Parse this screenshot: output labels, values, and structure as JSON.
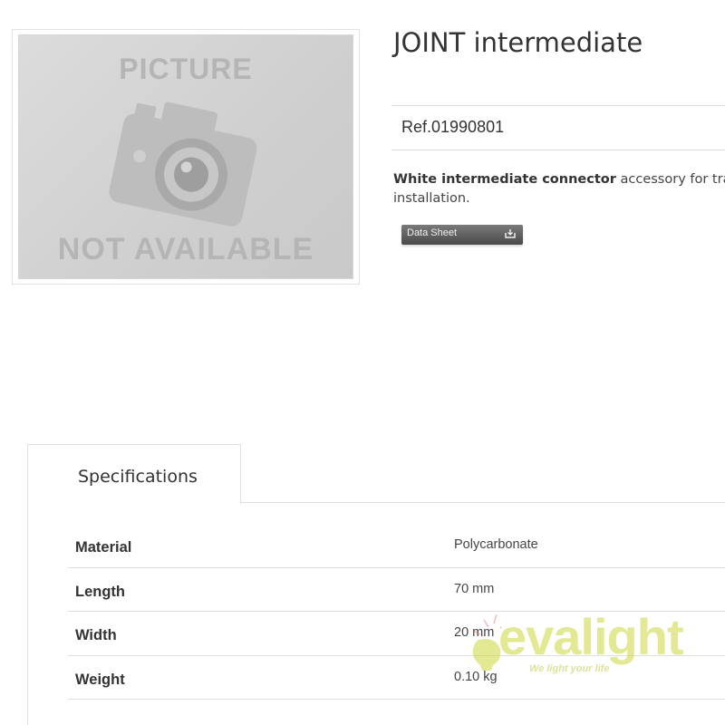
{
  "image_placeholder": {
    "top_text": "PICTURE",
    "bottom_text": "NOT AVAILABLE",
    "icon": "camera-icon"
  },
  "product": {
    "title": "JOINT intermediate",
    "reference": "Ref.01990801",
    "description_bold": "White intermediate connector",
    "description_rest": " accessory for track",
    "description_line2": "installation.",
    "datasheet_button": "Data Sheet",
    "datasheet_icon": "download-icon"
  },
  "tabs": [
    {
      "label": "Specifications",
      "active": true
    }
  ],
  "specifications": [
    {
      "label": "Material",
      "value": "Polycarbonate"
    },
    {
      "label": "Length",
      "value": "70 mm"
    },
    {
      "label": "Width",
      "value": "20 mm"
    },
    {
      "label": "Weight",
      "value": "0.10 kg"
    }
  ],
  "watermark": {
    "brand": "evalight",
    "slogan": "We light your life"
  },
  "colors": {
    "watermark_accent": "#cdd63a",
    "watermark_bulb": "#d9534f",
    "button_bg": "#5a5a5a",
    "border": "#e0e0e0"
  }
}
